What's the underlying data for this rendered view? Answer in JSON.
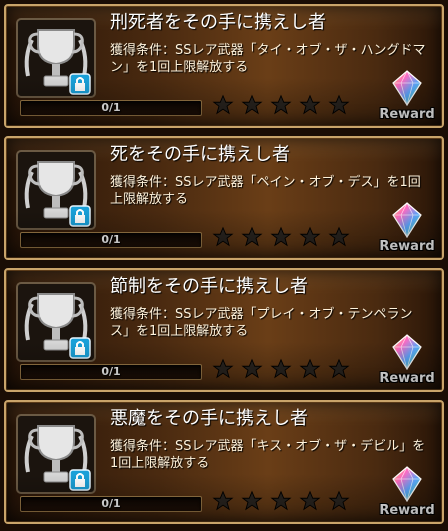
{
  "reward_label": "Reward",
  "icons": {
    "trophy": "silver-trophy-icon",
    "lock": "lock-badge-icon",
    "star": "star-icon",
    "gem": "rainbow-gem-icon"
  },
  "colors": {
    "frame": "#c9a46a",
    "title_text": "#ffffff",
    "body_text": "#fff3dc",
    "star": "#2a2520"
  },
  "achievements": [
    {
      "title": "刑死者をその手に携えし者",
      "condition": "獲得条件：SSレア武器「タイ・オブ・ザ・ハングドマン」を1回上限解放する",
      "progress_text": "0/1",
      "progress": 0,
      "stars_total": 5,
      "stars_filled": 0
    },
    {
      "title": "死をその手に携えし者",
      "condition": "獲得条件：SSレア武器「ペイン・オブ・デス」を1回上限解放する",
      "progress_text": "0/1",
      "progress": 0,
      "stars_total": 5,
      "stars_filled": 0
    },
    {
      "title": "節制をその手に携えし者",
      "condition": "獲得条件：SSレア武器「プレイ・オブ・テンペランス」を1回上限解放する",
      "progress_text": "0/1",
      "progress": 0,
      "stars_total": 5,
      "stars_filled": 0
    },
    {
      "title": "悪魔をその手に携えし者",
      "condition": "獲得条件：SSレア武器「キス・オブ・ザ・デビル」を1回上限解放する",
      "progress_text": "0/1",
      "progress": 0,
      "stars_total": 5,
      "stars_filled": 0
    }
  ]
}
